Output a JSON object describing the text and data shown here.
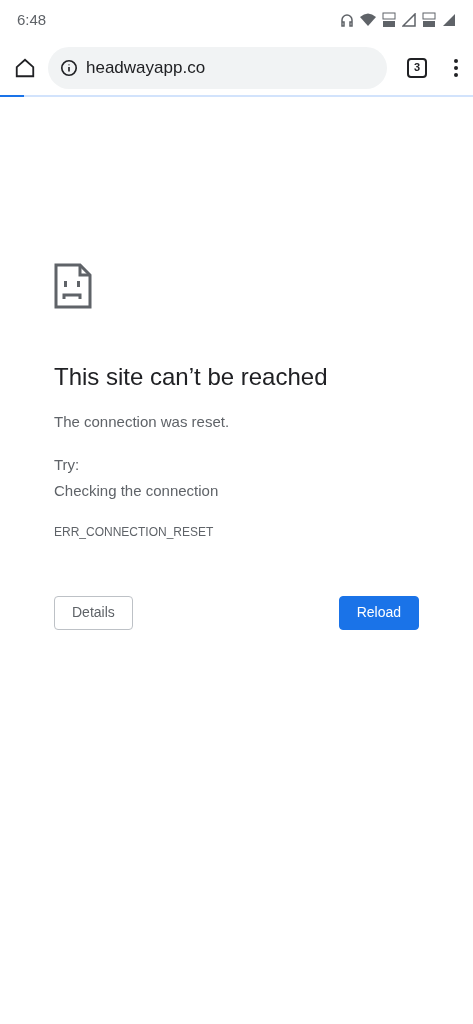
{
  "status_bar": {
    "time": "6:48"
  },
  "toolbar": {
    "url": "headwayapp.co",
    "tab_count": "3",
    "load_progress": {
      "level": 0.05
    }
  },
  "error_page": {
    "title": "This site can’t be reached",
    "message": "The connection was reset.",
    "try_label": "Try:",
    "suggestions": [
      "Checking the connection"
    ],
    "error_code": "ERR_CONNECTION_RESET"
  },
  "buttons": [
    {
      "label": "Details",
      "kind": "secondary"
    },
    {
      "label": "Reload",
      "kind": "primary"
    }
  ]
}
